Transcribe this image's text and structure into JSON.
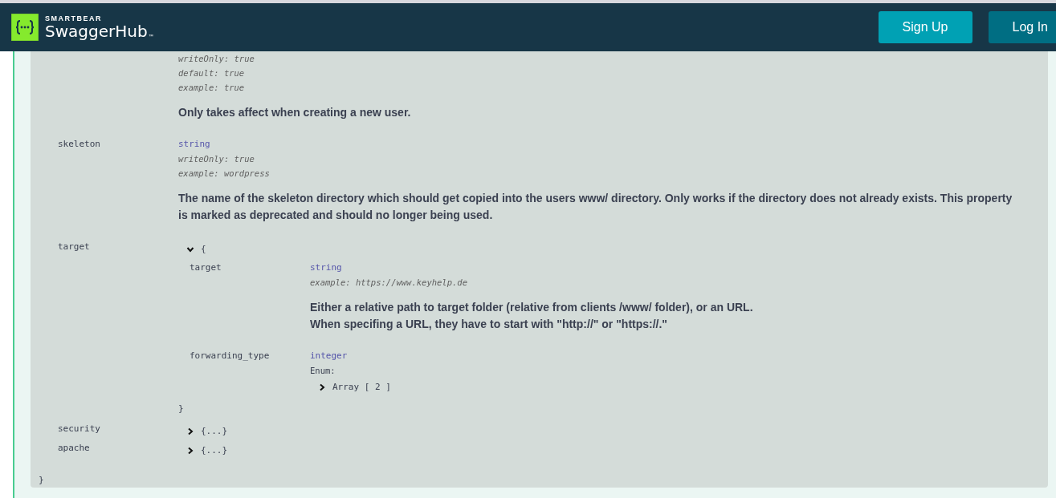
{
  "header": {
    "brand": "SMARTBEAR",
    "product": "SwaggerHub",
    "trademark": "™",
    "buttons": [
      {
        "label": "Sign Up",
        "kind": "primary"
      },
      {
        "label": "Log In",
        "kind": "secondary"
      }
    ]
  },
  "model": {
    "top_fragment": {
      "meta": [
        "writeOnly: true",
        "default: true",
        "example: true"
      ],
      "description": [
        "Only takes affect when creating a new user."
      ]
    },
    "properties": [
      {
        "name": "skeleton",
        "kind": "scalar",
        "type": "string",
        "meta": [
          "writeOnly: true",
          "example: wordpress"
        ],
        "description": [
          "The name of the skeleton directory which should get copied into the users www/ directory. Only works if the directory does not already exists. This property is marked as deprecated and should no longer being used."
        ]
      },
      {
        "name": "target",
        "kind": "object",
        "expanded": true,
        "open": "{",
        "close": "}",
        "children": [
          {
            "name": "target",
            "kind": "scalar",
            "type": "string",
            "meta": [
              "example: https://www.keyhelp.de"
            ],
            "description": [
              "Either a relative path to target folder (relative from clients /www/ folder), or an URL.",
              "When specifing a URL, they have to start with \"http://\" or \"https://.\""
            ]
          },
          {
            "name": "forwarding_type",
            "kind": "scalar",
            "type": "integer",
            "enum": {
              "label": "Enum:",
              "toggle": {
                "label": "Array [ 2 ]",
                "expanded": false
              }
            }
          }
        ]
      },
      {
        "name": "security",
        "kind": "object",
        "expanded": false,
        "summary": "{...}"
      },
      {
        "name": "apache",
        "kind": "object",
        "expanded": false,
        "summary": "{...}"
      }
    ],
    "close": "}"
  }
}
